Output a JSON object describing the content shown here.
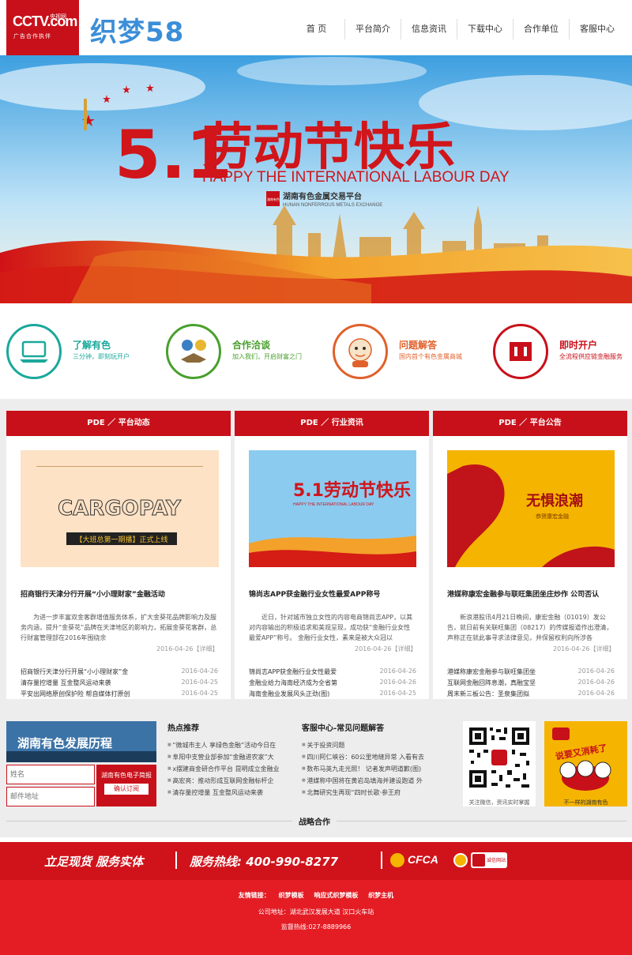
{
  "header": {
    "cctv": {
      "brand": "CCTV.com",
      "sub": "央视网",
      "tagline": "广告合作执伴"
    },
    "site_logo": "织梦58",
    "nav": [
      "首 页",
      "平台简介",
      "信息资讯",
      "下载中心",
      "合作单位",
      "客服中心"
    ]
  },
  "banner": {
    "number": "5.1",
    "title_cn": "劳动节快乐",
    "title_en": "HAPPY THE INTERNATIONAL LABOUR DAY",
    "seal": "湖南有色",
    "org_cn": "湖南有色金属交易平台",
    "org_en": "HUNAN NONFERROUS METALS EXCHANGE"
  },
  "features": [
    {
      "title": "了解有色",
      "desc": "三分钟，即刻玩开户",
      "color": "#1aa89b",
      "icon": "laptop-icon"
    },
    {
      "title": "合作洽谈",
      "desc": "加入我们，开启财富之门",
      "color": "#48a02c",
      "icon": "handshake-icon"
    },
    {
      "title": "问题解答",
      "desc": "国内首个有色金属商城",
      "color": "#e0612b",
      "icon": "mascot-icon"
    },
    {
      "title": "即时开户",
      "desc": "全流程供应链金融服务",
      "color": "#c8101a",
      "icon": "account-icon"
    }
  ],
  "columns": [
    {
      "label": "PDE ／ 平台动态",
      "image": {
        "caption": "【大班总第一期播】正式上线",
        "text": "CARGOPAY"
      },
      "title": "招商银行天津分行开展“小小理财家”金融活动",
      "excerpt": "为进一步丰富双金客群增值服务体系，扩大金葵花品牌影响力及服务内涵，提升“金葵花”品牌在天津地区的影响力，拓展金葵花客群，总行财富管理部在2016年围绕余",
      "date": "2016-04-26【详细】",
      "list": [
        {
          "t": "招商银行天津分行开展“小小理财家”金",
          "d": "2016-04-26"
        },
        {
          "t": "清存量控增量 互金整风运动来袭",
          "d": "2016-04-25"
        },
        {
          "t": "平安出网络原创保护险 帮自媒体打原创",
          "d": "2016-04-25"
        }
      ]
    },
    {
      "label": "PDE ／ 行业资讯",
      "image": {
        "caption": "5.1劳动节快乐",
        "text": "HAPPY THE INTERNATIONAL LABOUR DAY"
      },
      "title": "锦尚志APP获金融行业女性最爱APP称号",
      "excerpt": "近日，针对城市独立女性的内容电商锦尚志APP，以其对内容输出的积极追求和美观呈现，成功获“金融行业女性最爱APP”称号。 金融行业女性，素来是被大众冠以",
      "date": "2016-04-26【详细】",
      "list": [
        {
          "t": "锦尚志APP获金融行业女性最爱",
          "d": "2016-04-26"
        },
        {
          "t": "金融业给力海南经济成为全省第",
          "d": "2016-04-26"
        },
        {
          "t": "海南金融业发展风头正劲(图)",
          "d": "2016-04-25"
        }
      ]
    },
    {
      "label": "PDE ／ 平台公告",
      "image": {
        "caption": "恭贺康宏金融",
        "text": "无惧浪潮"
      },
      "title": "港媒称康宏金融参与联旺集团坐庄炒作 公司否认",
      "excerpt": "新浪港股讯4月21日晚间，康宏金融（01019）发公告，就日前有关联旺集团（08217）的传媒报道作出澄清，声称正在就此事寻求法律意见，并保留权利向所涉各",
      "date": "2016-04-26【详细】",
      "list": [
        {
          "t": "港媒称康宏金融参与联旺集团坐",
          "d": "2016-04-26"
        },
        {
          "t": "互联网金融回阵息潮，真融宝坚",
          "d": "2016-04-26"
        },
        {
          "t": "周末新三板公告：圣泉集团拟",
          "d": "2016-04-26"
        }
      ]
    }
  ],
  "history": {
    "title": "湖南有色发展历程"
  },
  "subscribe": {
    "name_placeholder": "姓名",
    "email_placeholder": "邮件地址",
    "label": "湖南有色电子简报",
    "button": "确认订阅"
  },
  "hot": {
    "title": "热点推荐",
    "items": [
      "“微城市主人 享绿色金融”活动今日在",
      "阜阳中支营业部参加“金融进农家”大",
      "x摆建商金研合作平台 昆明成立金融业",
      "高宏亮：推动形成互联网金融标杆企",
      "清存量控增量 互金整风运动来袭"
    ]
  },
  "faq": {
    "title": "客服中心-常见问题解答",
    "items": [
      "关于投资问题",
      "四川阿仁峡谷：60公里地缝异常 入看有去",
      "数布马英九走光照！ 记者发声明道歉(图)",
      "港媒称中国将在黄岩岛填海并建设跑道 外",
      "北舞研究生再现“四时长歌·参王府"
    ]
  },
  "qr": {
    "caption": "关注微信，资讯实时掌握"
  },
  "cartoon": {
    "headline": "说要又消耗了",
    "caption": "不一样的湖南有色"
  },
  "partners": {
    "title": "战略合作"
  },
  "redbar": {
    "slogan": "立足现货 服务实体",
    "hotline": "服务热线: 400-990-8277",
    "cfca": "CFCA",
    "badge": "诚信网站"
  },
  "footer": {
    "links_label": "友情链接：",
    "links": [
      "织梦模板",
      "响应式织梦模板",
      "织梦主机"
    ],
    "address": "公司地址：湖北武汉发展大道 汉口火车站",
    "phone": "监督热线:027-8889966"
  }
}
